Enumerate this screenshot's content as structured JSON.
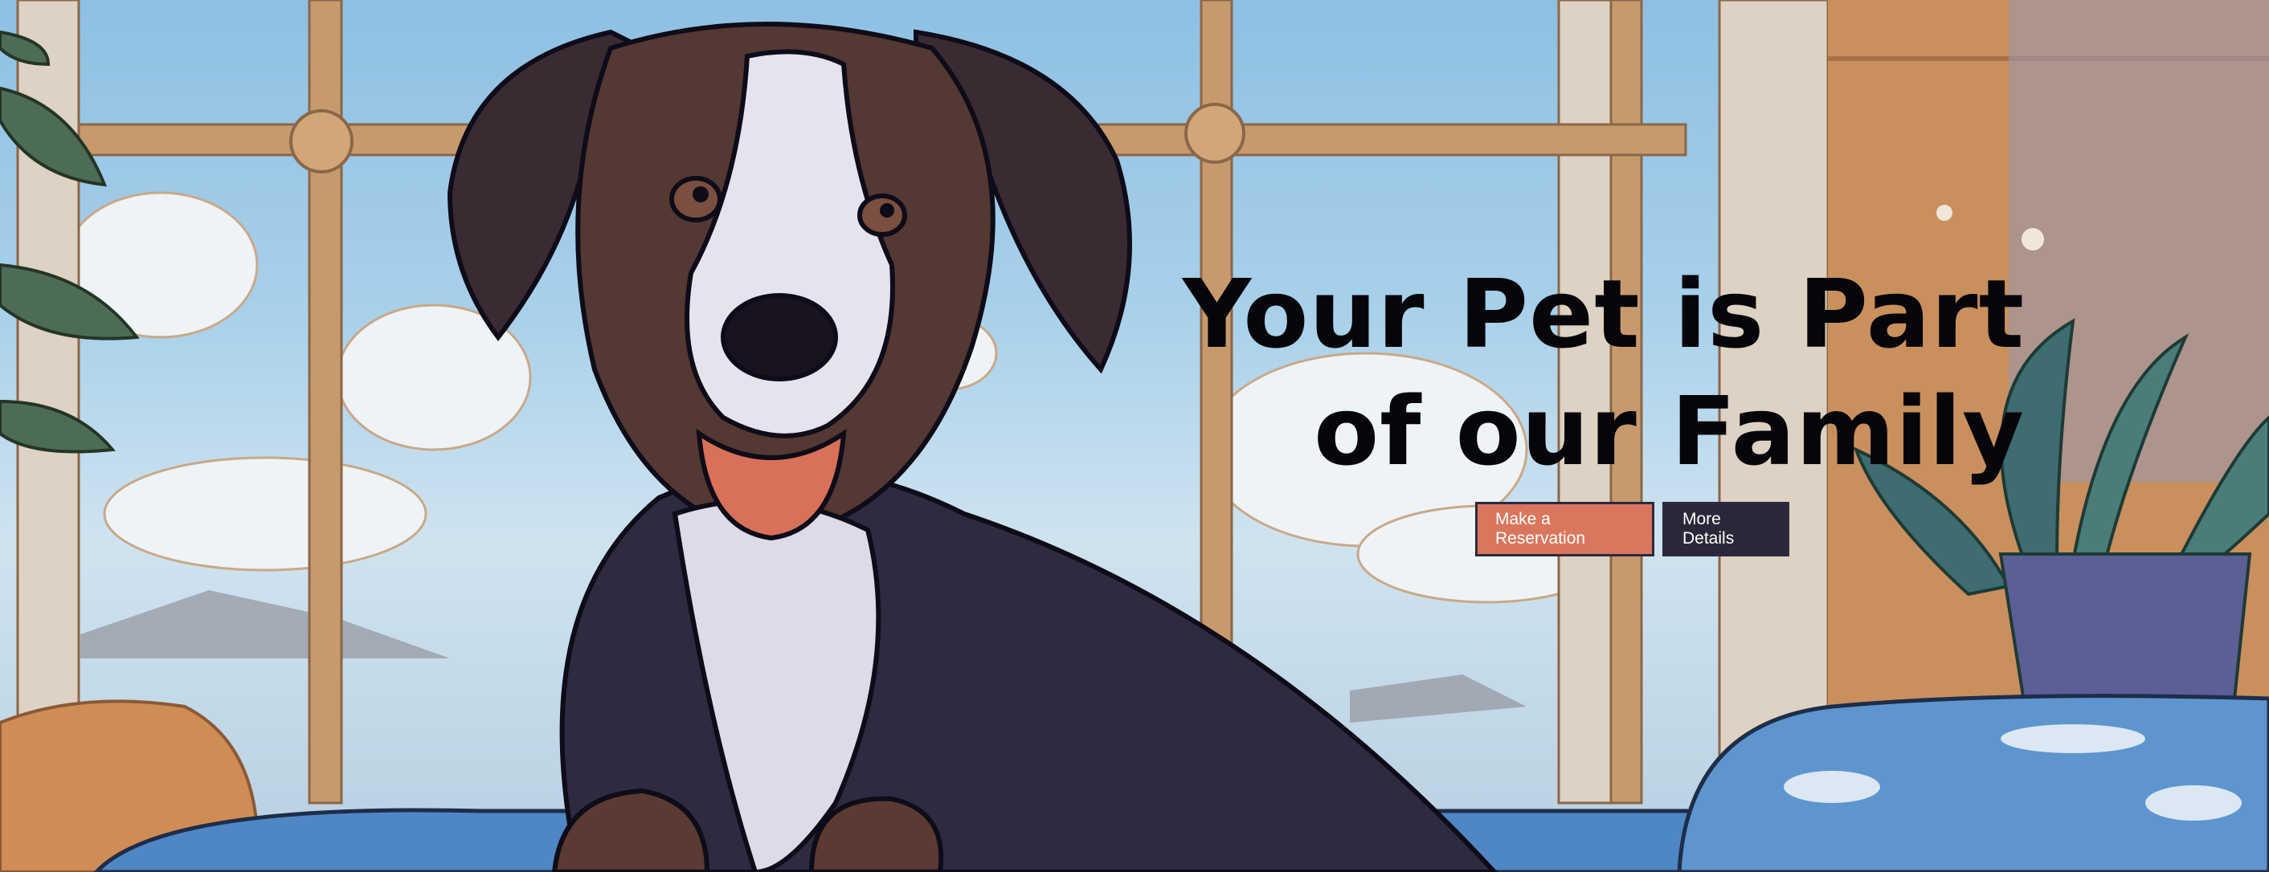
{
  "hero": {
    "headline_line1": "Your Pet is Part",
    "headline_line2": "of our Family",
    "reservation_button_label": "Make a Reservation",
    "details_button_label": "More Details"
  },
  "colors": {
    "headline_text": "#06060a",
    "primary_button": "#d9765d",
    "secondary_button": "#2a2838",
    "button_border": "#2c2a3e",
    "sky": "#8ec0e3",
    "window_frame": "#c79a6d",
    "dog_dark_fur": "#2e2a3f",
    "dog_brown_fur": "#5a3a32",
    "blanket": "#4f86c4"
  }
}
